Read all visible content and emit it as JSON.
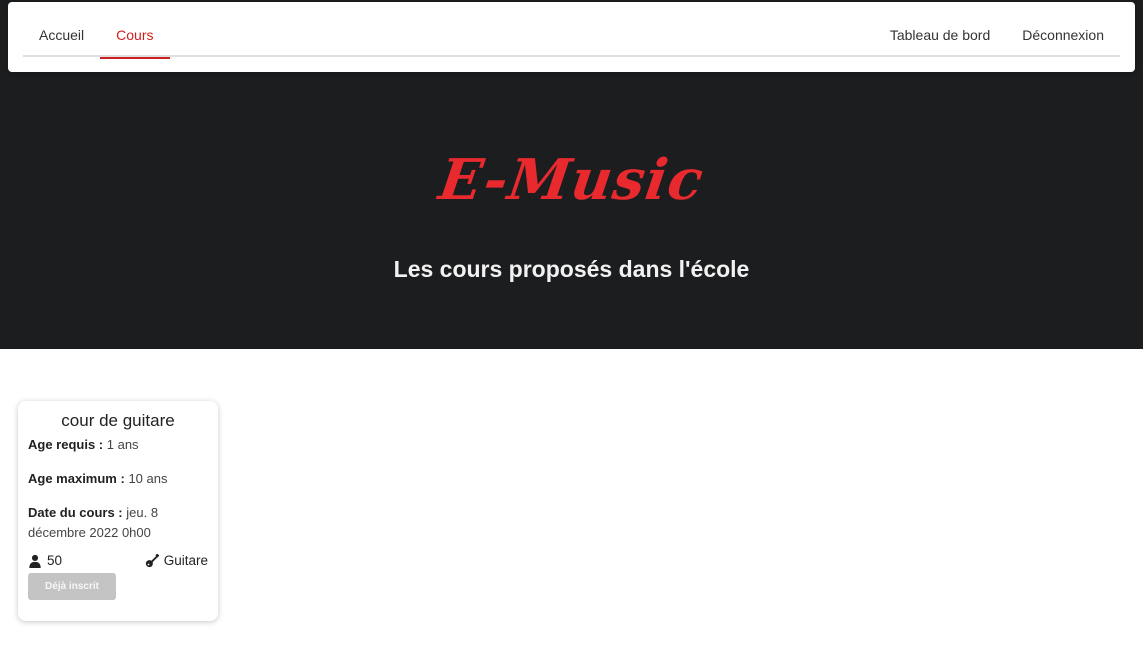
{
  "nav": {
    "left_items": [
      {
        "label": "Accueil",
        "active": false
      },
      {
        "label": "Cours",
        "active": true
      }
    ],
    "right_items": [
      {
        "label": "Tableau de bord"
      },
      {
        "label": "Déconnexion"
      }
    ]
  },
  "hero": {
    "logo": "E-Music",
    "title": "Les cours proposés dans l'école"
  },
  "course": {
    "title": "cour de guitare",
    "age_required_label": "Age requis :",
    "age_required_value": "1 ans",
    "age_max_label": "Age maximum :",
    "age_max_value": "10 ans",
    "date_label": "Date du cours :",
    "date_value": "jeu. 8 décembre 2022 0h00",
    "capacity": "50",
    "capacity_icon": "user-icon",
    "instrument": "Guitare",
    "instrument_icon": "guitar-icon",
    "button_label": "Déjà inscrit"
  },
  "colors": {
    "accent": "#cc1f1f",
    "hero_bg": "#1c1d1f",
    "logo": "#e8292e",
    "button_disabled": "#c4c4c4"
  }
}
